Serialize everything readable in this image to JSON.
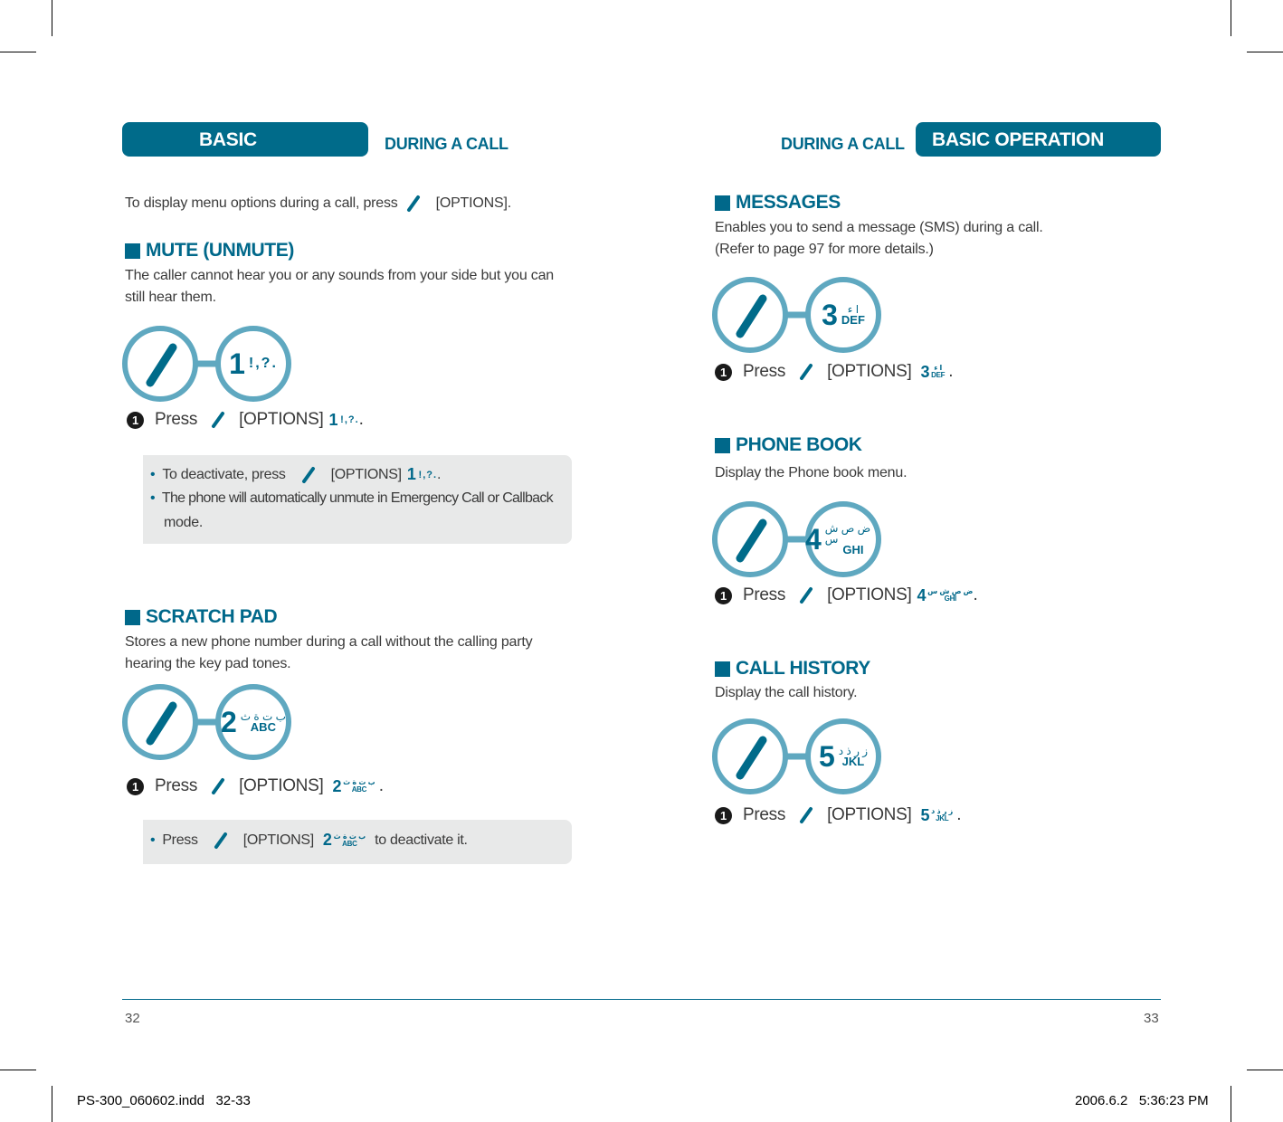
{
  "left_page": {
    "header": {
      "section": "BASIC OPERATION",
      "subsection": "DURING A CALL"
    },
    "intro": {
      "before": "To display menu options during a call, press",
      "after": "[OPTIONS]."
    },
    "sections": [
      {
        "title": "MUTE (UNMUTE)",
        "description_lines": [
          "The caller cannot hear you or any sounds from your side but you can",
          "still hear them."
        ],
        "key": {
          "number": "1",
          "symbols": "!,?.",
          "latin": "",
          "arabic": ""
        },
        "step": {
          "index": "1",
          "press": "Press",
          "options": "[OPTIONS]",
          "end": "."
        },
        "notes": [
          {
            "before": "To deactivate, press",
            "options": "[OPTIONS]",
            "end": "."
          },
          {
            "text": "The phone will automatically unmute in Emergency Call or Callback",
            "continuation": "mode."
          }
        ]
      },
      {
        "title": "SCRATCH PAD",
        "description_lines": [
          "Stores a new phone number during a call without the calling party",
          "hearing the key pad tones."
        ],
        "key": {
          "number": "2",
          "symbols": "",
          "latin": "ABC",
          "arabic": "ب ت ة ث"
        },
        "step": {
          "index": "1",
          "press": "Press",
          "options": "[OPTIONS]",
          "end": "."
        },
        "notes": [
          {
            "before": "Press",
            "options": "[OPTIONS]",
            "after": "to deactivate it."
          }
        ]
      }
    ],
    "page_number": "32"
  },
  "right_page": {
    "header": {
      "section": "BASIC OPERATION",
      "subsection": "DURING A CALL"
    },
    "sections": [
      {
        "title": "MESSAGES",
        "description_lines": [
          "Enables you to send a message (SMS) during a call.",
          "(Refer to page 97 for more details.)"
        ],
        "key": {
          "number": "3",
          "latin": "DEF",
          "arabic": "ا ء"
        },
        "step": {
          "index": "1",
          "press": "Press",
          "options": "[OPTIONS]",
          "end": "."
        }
      },
      {
        "title": "PHONE BOOK",
        "description_lines": [
          "Display the Phone book menu."
        ],
        "key": {
          "number": "4",
          "latin": "GHI",
          "arabic": "ض ص ش س"
        },
        "step": {
          "index": "1",
          "press": "Press",
          "options": "[OPTIONS]",
          "end": "."
        }
      },
      {
        "title": "CALL HISTORY",
        "description_lines": [
          "Display the call history."
        ],
        "key": {
          "number": "5",
          "latin": "JKL",
          "arabic": "ز ر ذ د"
        },
        "step": {
          "index": "1",
          "press": "Press",
          "options": "[OPTIONS]",
          "end": "."
        }
      }
    ],
    "page_number": "33"
  },
  "slug": {
    "file": "PS-300_060602.indd   32-33",
    "timestamp": "2006.6.2   5:36:23 PM"
  },
  "icons": {
    "options_key": "slash-soft-key-icon",
    "section_marker": "square-bullet-icon",
    "step_marker": "circled-one-icon"
  },
  "colors": {
    "brand": "#006b8a",
    "ring": "#5fa8c0",
    "note_bg": "#e8e9e9"
  }
}
